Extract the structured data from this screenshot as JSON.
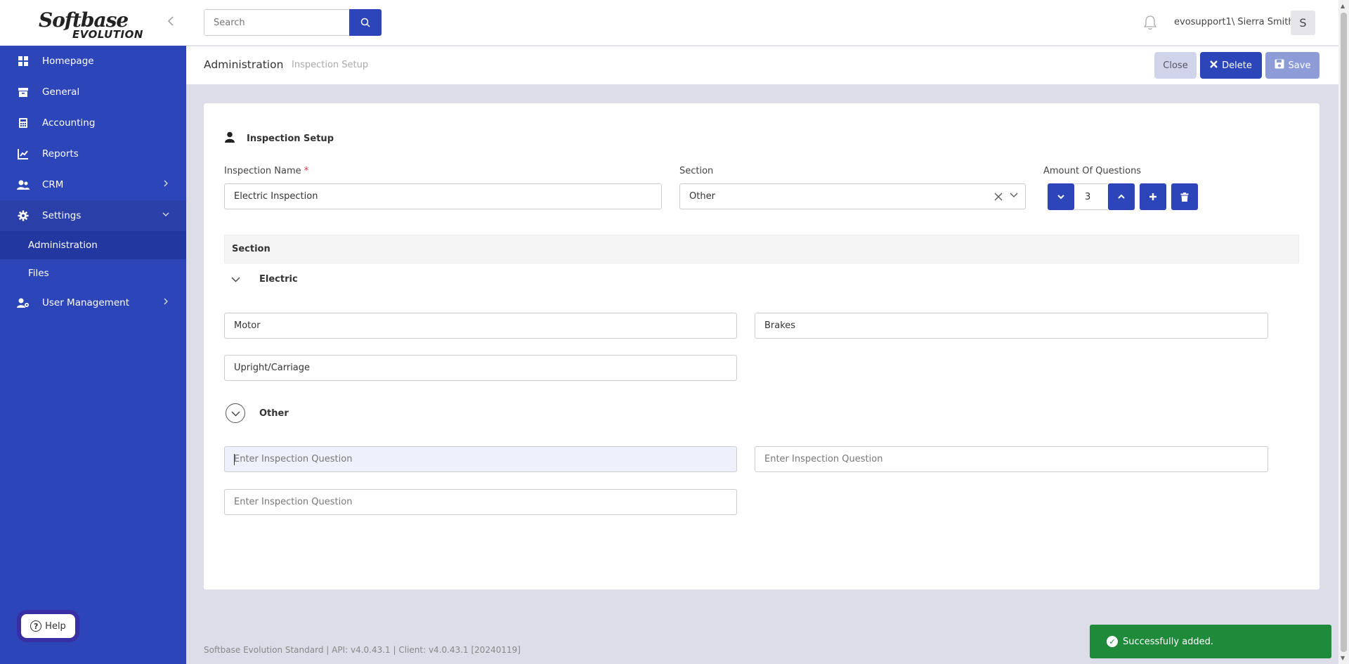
{
  "brand": {
    "line1": "Softbase",
    "line2": "EVOLUTION"
  },
  "sidebar": {
    "items": [
      {
        "label": "Homepage",
        "icon": "grid-icon"
      },
      {
        "label": "General",
        "icon": "archive-icon"
      },
      {
        "label": "Accounting",
        "icon": "calculator-icon"
      },
      {
        "label": "Reports",
        "icon": "chart-line-icon"
      },
      {
        "label": "CRM",
        "icon": "users-icon"
      },
      {
        "label": "Settings",
        "icon": "gear-icon"
      },
      {
        "label": "User Management",
        "icon": "user-cog-icon"
      }
    ],
    "sub_items": [
      {
        "label": "Administration"
      },
      {
        "label": "Files"
      }
    ],
    "help_label": "Help"
  },
  "header": {
    "search_placeholder": "Search",
    "user_name": "evosupport1\\ Sierra Smith",
    "avatar_letter": "S"
  },
  "breadcrumb": {
    "main": "Administration",
    "sub": "Inspection Setup"
  },
  "actions": {
    "close": "Close",
    "delete": "Delete",
    "save": "Save"
  },
  "form": {
    "title": "Inspection Setup",
    "name_label": "Inspection Name",
    "required_mark": "*",
    "name_value": "Electric Inspection",
    "section_label": "Section",
    "section_value": "Other",
    "amount_label": "Amount Of Questions",
    "amount_value": "3",
    "table_header": "Section",
    "groups": [
      {
        "label": "Electric",
        "questions": [
          "Motor",
          "Brakes",
          "Upright/Carriage"
        ]
      },
      {
        "label": "Other",
        "placeholder": "Enter Inspection Question"
      }
    ]
  },
  "footer": "Softbase Evolution Standard | API: v4.0.43.1 | Client: v4.0.43.1 [20240119]",
  "toast": "Successfully added.",
  "colors": {
    "primary": "#2c45b8",
    "success": "#1f8b3a"
  }
}
